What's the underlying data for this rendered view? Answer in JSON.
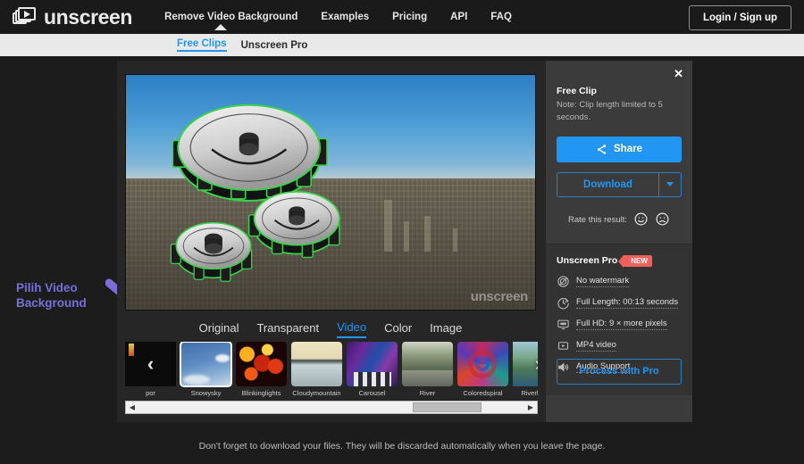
{
  "brand": {
    "name": "unscreen",
    "logo_icon": "video-frames-play-icon"
  },
  "topnav": {
    "items": [
      {
        "label": "Remove Video Background"
      },
      {
        "label": "Examples"
      },
      {
        "label": "Pricing"
      },
      {
        "label": "API"
      },
      {
        "label": "FAQ"
      }
    ],
    "login_label": "Login / Sign up"
  },
  "subnav": {
    "items": [
      {
        "label": "Free Clips",
        "active": true
      },
      {
        "label": "Unscreen Pro",
        "active": false
      }
    ]
  },
  "preview": {
    "watermark": "unscreen",
    "subject": "three-3d-gears-green-outline",
    "background": "city-skyline-aerial"
  },
  "background_tabs": {
    "items": [
      {
        "label": "Original",
        "active": false
      },
      {
        "label": "Transparent",
        "active": false
      },
      {
        "label": "Video",
        "active": true
      },
      {
        "label": "Color",
        "active": false
      },
      {
        "label": "Image",
        "active": false
      }
    ]
  },
  "thumbnails": {
    "prev_arrow": "‹",
    "next_arrow": "›",
    "items": [
      {
        "label": "por",
        "selected": false
      },
      {
        "label": "Snowysky",
        "selected": true
      },
      {
        "label": "Blinkinglights",
        "selected": false
      },
      {
        "label": "Cloudymountain",
        "selected": false
      },
      {
        "label": "Carousel",
        "selected": false
      },
      {
        "label": "River",
        "selected": false
      },
      {
        "label": "Coloredspiral",
        "selected": false
      },
      {
        "label": "Riverbridge",
        "selected": false
      }
    ]
  },
  "scrollbar": {
    "left_arrow": "◀",
    "right_arrow": "▶",
    "thumb_position_pct": 71,
    "thumb_width_pct": 18
  },
  "panel": {
    "close_label": "✕",
    "free": {
      "title": "Free Clip",
      "note": "Note: Clip length limited to 5 seconds.",
      "share_label": "Share",
      "share_icon": "share-nodes-icon",
      "download_label": "Download",
      "download_caret_icon": "chevron-down-icon",
      "rate_label": "Rate this result:",
      "rate_positive_icon": "smiley-happy-icon",
      "rate_negative_icon": "smiley-sad-icon"
    },
    "pro": {
      "title": "Unscreen Pro",
      "badge": "NEW",
      "features": [
        {
          "icon": "no-watermark-icon",
          "label": "No watermark"
        },
        {
          "icon": "clock-icon",
          "label": "Full Length: 00:13 seconds"
        },
        {
          "icon": "monitor-icon",
          "label": "Full HD: 9 × more pixels"
        },
        {
          "icon": "play-box-icon",
          "label": "MP4 video"
        },
        {
          "icon": "speaker-icon",
          "label": "Audio Support"
        }
      ],
      "cta_label": "Process with Pro"
    }
  },
  "annotation": {
    "line1": "Pilih Video",
    "line2": "Background",
    "color": "#7a6fd8",
    "arrow_icon": "arrow-down-right-icon"
  },
  "footer": {
    "text": "Don't forget to download your files. They will be discarded automatically when you leave the page."
  },
  "colors": {
    "accent_blue": "#2196f3",
    "badge_red": "#f0615c",
    "panel_bg": "#3b3b3b",
    "pro_bg": "#333333",
    "stage_bg": "#1c1c1c"
  }
}
